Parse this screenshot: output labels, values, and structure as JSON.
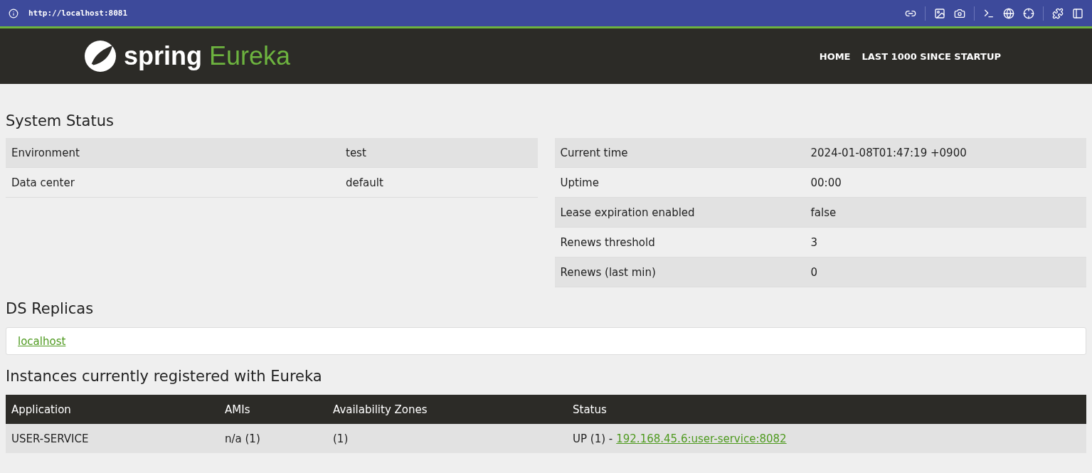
{
  "browser": {
    "url": "http://localhost:8081"
  },
  "header": {
    "brand": "spring",
    "product": "Eureka",
    "nav": [
      {
        "label": "HOME"
      },
      {
        "label": "LAST 1000 SINCE STARTUP"
      }
    ]
  },
  "system_status": {
    "title": "System Status",
    "left": [
      {
        "label": "Environment",
        "value": "test"
      },
      {
        "label": "Data center",
        "value": "default"
      }
    ],
    "right": [
      {
        "label": "Current time",
        "value": "2024-01-08T01:47:19 +0900"
      },
      {
        "label": "Uptime",
        "value": "00:00"
      },
      {
        "label": "Lease expiration enabled",
        "value": "false"
      },
      {
        "label": "Renews threshold",
        "value": "3"
      },
      {
        "label": "Renews (last min)",
        "value": "0"
      }
    ]
  },
  "ds_replicas": {
    "title": "DS Replicas",
    "items": [
      "localhost"
    ]
  },
  "instances": {
    "title": "Instances currently registered with Eureka",
    "columns": [
      "Application",
      "AMIs",
      "Availability Zones",
      "Status"
    ],
    "rows": [
      {
        "application": "USER-SERVICE",
        "amis": "n/a (1)",
        "zones": "(1)",
        "status": "UP (1) -",
        "link": "192.168.45.6:user-service:8082"
      }
    ]
  }
}
